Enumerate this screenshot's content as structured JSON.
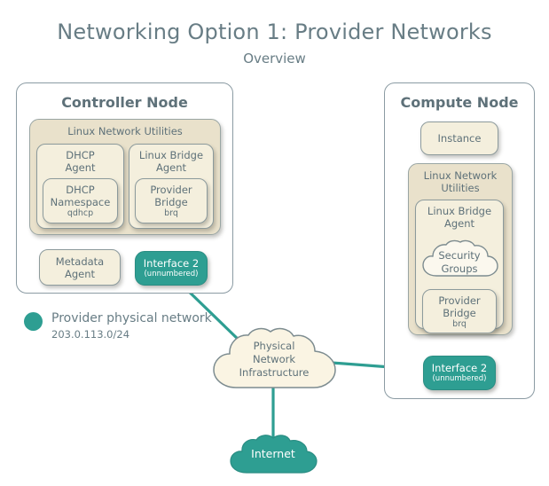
{
  "header": {
    "title": "Networking Option 1: Provider Networks",
    "subtitle": "Overview"
  },
  "colors": {
    "teal": "#2e9e92",
    "beige_group": "#e9e1cb",
    "beige_box": "#f4efdd",
    "text": "#5e7179",
    "border": "#8b9ba3",
    "background": "#ffffff"
  },
  "controller_node": {
    "title": "Controller Node",
    "utilities": {
      "label": "Linux Network Utilities",
      "dhcp_agent": {
        "label": "DHCP Agent",
        "line1": "DHCP",
        "line2": "Agent",
        "namespace": {
          "line1": "DHCP",
          "line2": "Namespace",
          "sub": "qdhcp"
        }
      },
      "bridge_agent": {
        "label": "Linux Bridge Agent",
        "line1": "Linux Bridge",
        "line2": "Agent",
        "provider_bridge": {
          "line1": "Provider",
          "line2": "Bridge",
          "sub": "brq"
        }
      }
    },
    "metadata_agent": {
      "line1": "Metadata",
      "line2": "Agent"
    },
    "interface": {
      "label": "Interface 2",
      "sub": "(unnumbered)"
    }
  },
  "compute_node": {
    "title": "Compute Node",
    "instance": {
      "label": "Instance"
    },
    "utilities": {
      "line1": "Linux Network",
      "line2": "Utilities",
      "bridge_agent": {
        "line1": "Linux Bridge",
        "line2": "Agent",
        "security_groups": {
          "line1": "Security",
          "line2": "Groups"
        },
        "provider_bridge": {
          "line1": "Provider",
          "line2": "Bridge",
          "sub": "brq"
        }
      }
    },
    "interface": {
      "label": "Interface 2",
      "sub": "(unnumbered)"
    }
  },
  "legend": {
    "name": "Provider physical network",
    "cidr": "203.0.113.0/24"
  },
  "physical_network_cloud": {
    "line1": "Physical",
    "line2": "Network",
    "line3": "Infrastructure"
  },
  "internet_cloud": {
    "label": "Internet"
  }
}
